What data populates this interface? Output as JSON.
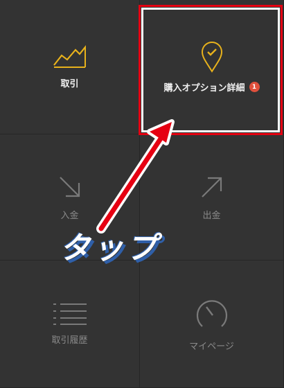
{
  "tiles": [
    {
      "label": "取引",
      "icon": "trend-chart-icon"
    },
    {
      "label": "購入オプション詳細",
      "icon": "location-check-icon",
      "badge": "1"
    },
    {
      "label": "入金",
      "icon": "arrow-down-right-icon"
    },
    {
      "label": "出金",
      "icon": "arrow-up-right-icon"
    },
    {
      "label": "取引履歴",
      "icon": "list-icon"
    },
    {
      "label": "マイページ",
      "icon": "gauge-icon"
    }
  ],
  "annotation": {
    "text": "タップ"
  },
  "colors": {
    "accent": "#e8b21c",
    "highlight": "#e60012",
    "badge": "#e0503c",
    "tap_shadow": "#2f5fa8"
  }
}
